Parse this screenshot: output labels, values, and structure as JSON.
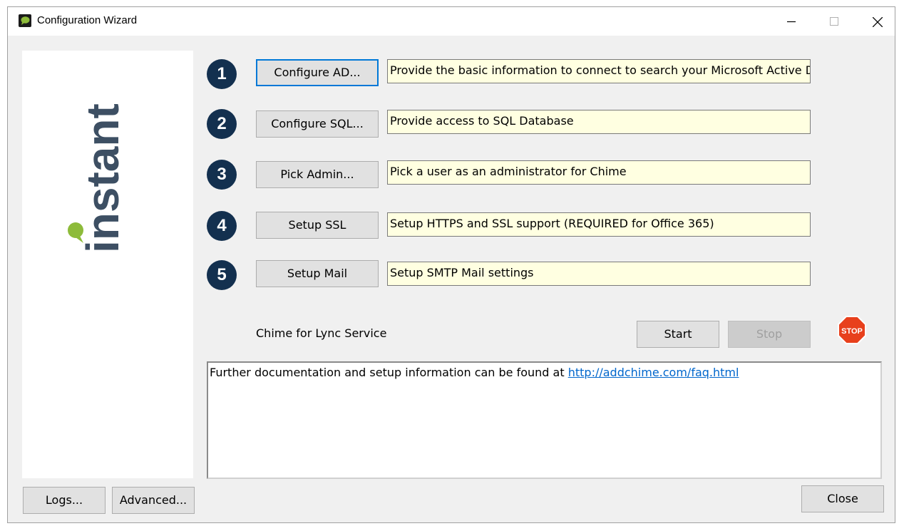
{
  "window": {
    "title": "Configuration Wizard",
    "controls": {
      "minimize": "minimize-icon",
      "maximize": "maximize-icon",
      "close": "close-icon"
    }
  },
  "logo": {
    "text": "instant",
    "color": "#3d4f63",
    "dot_color": "#8dbb3a"
  },
  "steps": [
    {
      "number": "1",
      "button": "Configure AD...",
      "description": "Provide the basic information to connect to search your Microsoft Active D"
    },
    {
      "number": "2",
      "button": "Configure SQL...",
      "description": "Provide access to SQL Database"
    },
    {
      "number": "3",
      "button": "Pick Admin...",
      "description": "Pick a user as an administrator for Chime"
    },
    {
      "number": "4",
      "button": "Setup SSL",
      "description": "Setup HTTPS and SSL support (REQUIRED for Office 365)"
    },
    {
      "number": "5",
      "button": "Setup Mail",
      "description": "Setup SMTP Mail settings"
    }
  ],
  "service": {
    "label": "Chime for Lync Service",
    "start_label": "Start",
    "stop_label": "Stop",
    "stop_icon_text": "STOP"
  },
  "info": {
    "text": "Further documentation and setup information can be found at ",
    "link": "http://addchime.com/faq.html"
  },
  "footer": {
    "logs_label": "Logs...",
    "advanced_label": "Advanced...",
    "close_label": "Close"
  },
  "colors": {
    "step_circle": "#13304f",
    "description_bg": "#ffffe1",
    "focus_border": "#0078d7",
    "link": "#0066cc",
    "stop_sign": "#e8401c"
  }
}
